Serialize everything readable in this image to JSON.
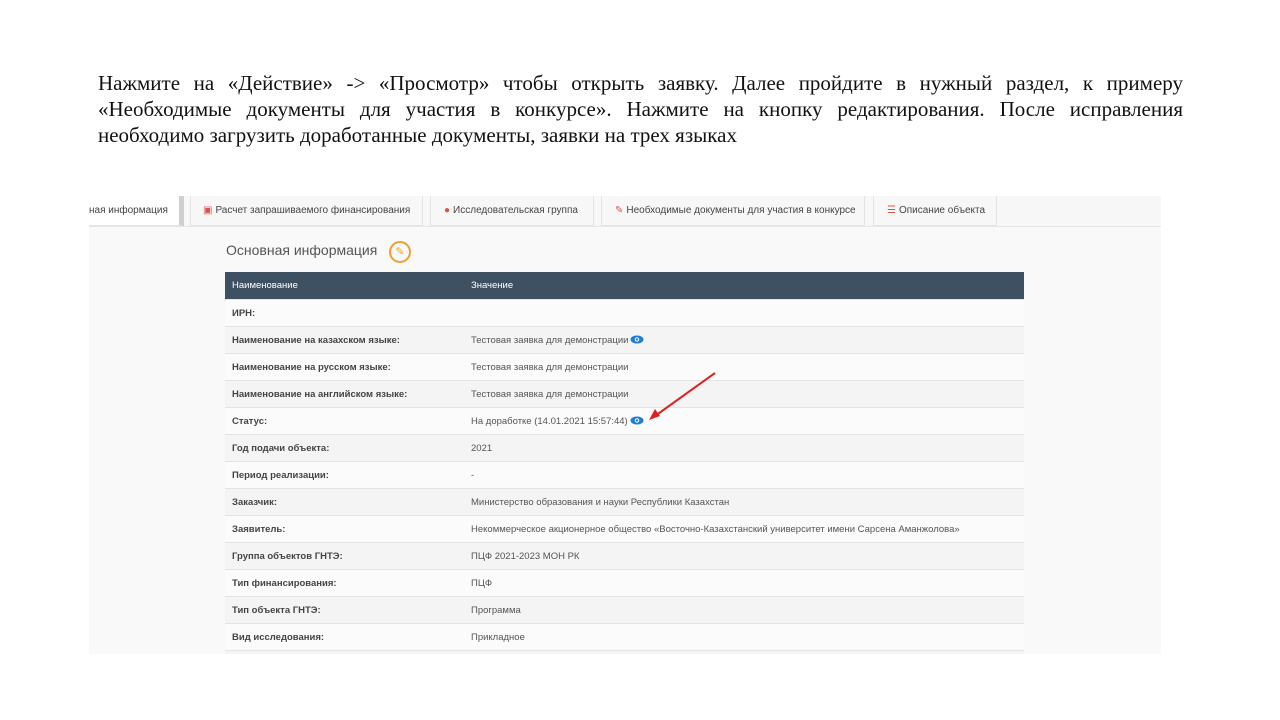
{
  "instruction": "Нажмите на «Действие» -> «Просмотр» чтобы открыть заявку. Далее пройдите в нужный раздел, к примеру «Необходимые документы для участия в конкурсе». Нажмите на кнопку редактирования. После исправления необходимо загрузить доработанные документы, заявки на трех языках",
  "tabs": [
    {
      "label": "ная информация",
      "icon": ""
    },
    {
      "label": "Расчет запрашиваемого финансирования",
      "icon": "money-icon"
    },
    {
      "label": "Исследовательская группа",
      "icon": "users-icon"
    },
    {
      "label": "Необходимые документы для участия в конкурсе",
      "icon": "paperclip-icon"
    },
    {
      "label": "Описание объекта",
      "icon": "list-icon"
    }
  ],
  "section": {
    "title": "Основная информация",
    "edit_icon": "pencil-icon"
  },
  "table": {
    "headers": [
      "Наименование",
      "Значение"
    ],
    "rows": [
      {
        "label": "ИРН:",
        "value": ""
      },
      {
        "label": "Наименование на казахском языке:",
        "value": "Тестовая заявка для демонстрации"
      },
      {
        "label": "Наименование на русском языке:",
        "value": "Тестовая заявка для демонстрации"
      },
      {
        "label": "Наименование на английском языке:",
        "value": "Тестовая заявка для демонстрации"
      },
      {
        "label": "Статус:",
        "value": "На доработке (14.01.2021 15:57:44)"
      },
      {
        "label": "Год подачи объекта:",
        "value": "2021"
      },
      {
        "label": "Период реализации:",
        "value": "-"
      },
      {
        "label": "Заказчик:",
        "value": "Министерство образования и науки Республики Казахстан"
      },
      {
        "label": "Заявитель:",
        "value": "Некоммерческое акционерное общество «Восточно-Казахстанский университет имени Сарсена Аманжолова»"
      },
      {
        "label": "Группа объектов ГНТЭ:",
        "value": "ПЦФ 2021-2023 МОН РК"
      },
      {
        "label": "Тип финансирования:",
        "value": "ПЦФ"
      },
      {
        "label": "Тип объекта ГНТЭ:",
        "value": "Программа"
      },
      {
        "label": "Вид исследования:",
        "value": "Прикладное"
      }
    ]
  },
  "colors": {
    "header_bg": "#3e5163",
    "accent": "#f0a030",
    "eye": "#1f7fd6",
    "arrow": "#e02020"
  }
}
